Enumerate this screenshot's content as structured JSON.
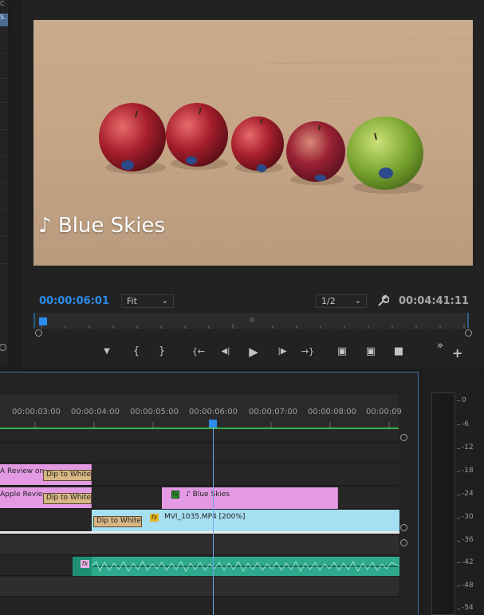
{
  "left_panel": {
    "tab_fragment": "C",
    "selected_fragment": "S."
  },
  "program_monitor": {
    "overlay_title": "♪ Blue Skies",
    "current_timecode": "00:00:06:01",
    "zoom": {
      "value": "Fit"
    },
    "resolution": {
      "value": "1/2"
    },
    "duration_timecode": "00:04:41:11",
    "colors": {
      "timecode_accent": "#2d8ceb"
    },
    "controls": [
      {
        "name": "add-marker-icon",
        "glyph": "▼"
      },
      {
        "name": "mark-in-icon",
        "glyph": "{"
      },
      {
        "name": "mark-out-icon",
        "glyph": "}"
      },
      {
        "name": "go-to-in-icon",
        "glyph": "{←"
      },
      {
        "name": "step-back-icon",
        "glyph": "◀|"
      },
      {
        "name": "play-icon",
        "glyph": "▶"
      },
      {
        "name": "step-forward-icon",
        "glyph": "|▶"
      },
      {
        "name": "go-to-out-icon",
        "glyph": "→}"
      },
      {
        "name": "lift-icon",
        "glyph": "▣"
      },
      {
        "name": "extract-icon",
        "glyph": "▣"
      },
      {
        "name": "export-frame-icon",
        "glyph": "■"
      }
    ],
    "more_glyph": "»",
    "add_glyph": "+",
    "settings_icon": "wrench-icon"
  },
  "timeline": {
    "ruler_labels": [
      "00:00:03:00",
      "00:00:04:00",
      "00:00:05:00",
      "00:00:06:00",
      "00:00:07:00",
      "00:00:08:00",
      "00:00:09"
    ],
    "clips": {
      "v3_pink_label": "A Review on",
      "v2_pink_label": "Apple Revie",
      "v3_transition": "Dip to White",
      "v2_transition": "Dip to White",
      "v1_transition": "Dip to White",
      "blue_skies_label": "♪ Blue Skies",
      "blue_skies_fx": "fx",
      "mvi_label": "MVI_1035.MP4 [200%]",
      "mvi_fx": "fx",
      "audio_fx": "fx"
    },
    "colors": {
      "playhead": "#2d8ceb",
      "video_clip": "#e39ae3",
      "audio_clip": "#2fa98d"
    }
  },
  "audio_meter": {
    "labels": [
      "0",
      "-6",
      "-12",
      "-18",
      "-24",
      "-30",
      "-36",
      "-42",
      "-48",
      "-54"
    ]
  }
}
